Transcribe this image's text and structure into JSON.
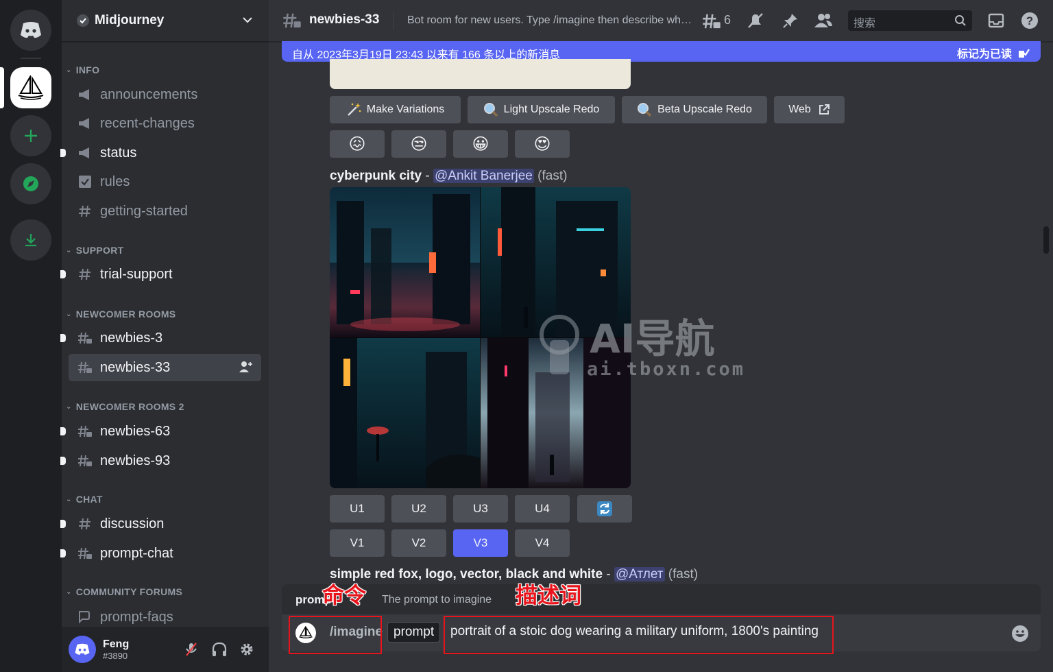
{
  "server": {
    "name": "Midjourney"
  },
  "categories": {
    "info": "INFO",
    "support": "SUPPORT",
    "newcomer": "NEWCOMER ROOMS",
    "newcomer2": "NEWCOMER ROOMS 2",
    "chat": "CHAT",
    "forums": "COMMUNITY FORUMS"
  },
  "channels": {
    "announcements": "announcements",
    "recent_changes": "recent-changes",
    "status": "status",
    "rules": "rules",
    "getting_started": "getting-started",
    "trial_support": "trial-support",
    "newbies_3": "newbies-3",
    "newbies_33": "newbies-33",
    "newbies_63": "newbies-63",
    "newbies_93": "newbies-93",
    "discussion": "discussion",
    "prompt_chat": "prompt-chat",
    "prompt_faqs": "prompt-faqs"
  },
  "user": {
    "name": "Feng",
    "tag": "#3890"
  },
  "header": {
    "channel": "newbies-33",
    "topic": "Bot room for new users. Type /imagine then describe what you want to draw. See https://docs.midjourney.com/ for more information",
    "threads_count": "6",
    "search_placeholder": "搜索"
  },
  "banner": {
    "text": "自从 2023年3月19日 23:43 以来有 166 条以上的新消息",
    "mark_read": "标记为已读"
  },
  "prev_buttons": {
    "make_variations": "Make Variations",
    "light_upscale": "Light Upscale Redo",
    "beta_upscale": "Beta Upscale Redo",
    "web": "Web"
  },
  "reactions": [
    "😖",
    "😒",
    "😀",
    "😍"
  ],
  "message1": {
    "prompt": "cyberpunk city",
    "sep": " - ",
    "mention": "@Ankit Banerjee",
    "mode": " (fast)"
  },
  "upscale_buttons": [
    "U1",
    "U2",
    "U3",
    "U4"
  ],
  "variation_buttons": [
    "V1",
    "V2",
    "V3",
    "V4"
  ],
  "message2": {
    "prompt": "simple red fox, logo, vector, black and white",
    "sep": " - ",
    "mention": "@Атлет",
    "mode": " (fast)"
  },
  "command_popup": {
    "option": "prompt",
    "description": "The prompt to imagine"
  },
  "composer": {
    "command": "/imagine",
    "param": "prompt",
    "value": "portrait of a stoic dog wearing a military uniform, 1800's painting"
  },
  "annotations": {
    "command_label": "命令",
    "prompt_label": "描述词"
  },
  "watermark": {
    "title": "AI导航",
    "url": "ai.tboxn.com"
  },
  "colors": {
    "accent": "#5865f2",
    "annotation_red": "#e8141c",
    "background": "#313338"
  }
}
